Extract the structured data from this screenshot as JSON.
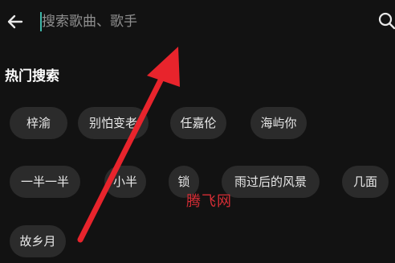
{
  "search": {
    "placeholder": "搜索歌曲、歌手",
    "value": ""
  },
  "section_title": "热门搜索",
  "hot_searches": [
    "梓渝",
    "别怕变老",
    "任嘉伦",
    "海屿你",
    "一半一半",
    "小半",
    "锁",
    "雨过后的风景",
    "几面",
    "故乡月"
  ],
  "watermark": "腾飞网",
  "colors": {
    "background": "#121212",
    "chip_background": "#2b2b2b",
    "caret": "#3fb6a8",
    "annotation_arrow": "#e8242c",
    "watermark": "#d42d35"
  },
  "icons": {
    "back": "back-arrow-icon",
    "search": "search-icon"
  }
}
